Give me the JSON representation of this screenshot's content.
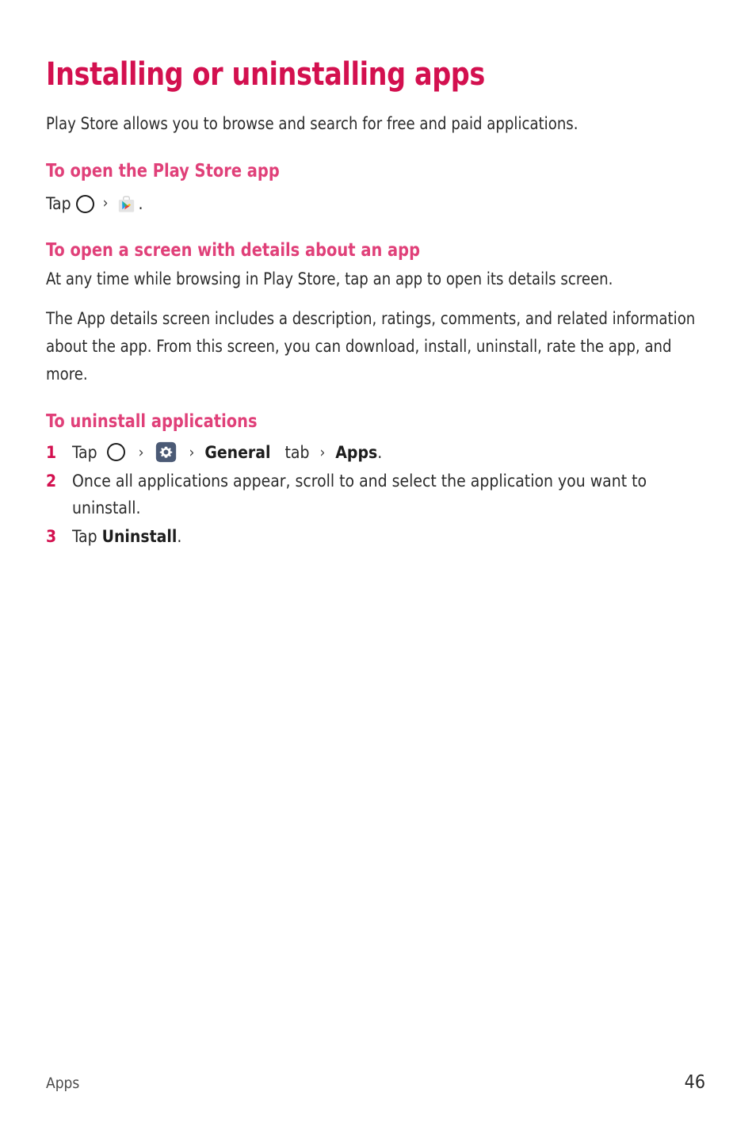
{
  "page": {
    "title": "Installing or uninstalling apps",
    "intro": "Play Store allows you to browse and search for free and paid applications."
  },
  "sections": [
    {
      "heading": "To open the Play Store app",
      "tap_label": "Tap",
      "icons": [
        "home-icon",
        "playstore-icon"
      ],
      "trailing": "."
    },
    {
      "heading": "To open a screen with details about an app",
      "paragraph_1": "At any time while browsing in Play Store, tap an app to open its details screen.",
      "paragraph_2": "The App details screen includes a description, ratings, comments, and related information about the app. From this screen, you can download, install, uninstall, rate the app, and more."
    },
    {
      "heading": "To uninstall applications",
      "steps": [
        {
          "number": "1",
          "prefix": "Tap",
          "icons": [
            "home-icon",
            "settings-icon"
          ],
          "bold_1": "General",
          "mid": "tab",
          "bold_2": "Apps",
          "suffix": "."
        },
        {
          "number": "2",
          "text": "Once all applications appear, scroll to and select the application you want to uninstall."
        },
        {
          "number": "3",
          "prefix": "Tap",
          "bold_1": "Uninstall",
          "suffix": "."
        }
      ]
    }
  ],
  "separator": "›",
  "footer": {
    "section_label": "Apps",
    "page_number": "46"
  },
  "colors": {
    "title_pink": "#d3104f",
    "heading_pink": "#e04079",
    "body_text": "#2b2b2b",
    "settings_icon_bg": "#4b5a75",
    "playstore_bag": "#e6e6e6"
  }
}
